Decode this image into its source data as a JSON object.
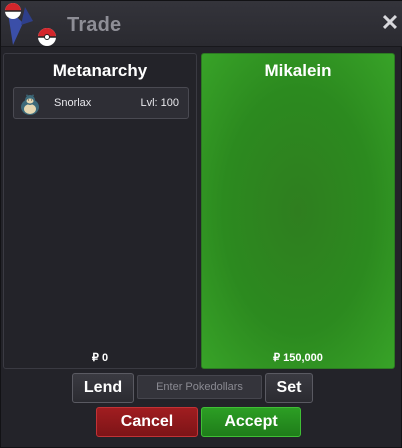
{
  "window": {
    "title": "Trade",
    "close_glyph": "✕",
    "logo_icon": "pokeball-logo-icon"
  },
  "left_panel": {
    "player_name": "Metanarchy",
    "items": [
      {
        "name": "Snorlax",
        "level": "Lvl: 100",
        "icon": "snorlax-sprite-icon"
      }
    ],
    "money": "₽ 0"
  },
  "right_panel": {
    "player_name": "Mikalein",
    "items": [],
    "money": "₽ 150,000",
    "accepted_color": "#2c8a1f"
  },
  "controls": {
    "lend_label": "Lend",
    "money_placeholder": "Enter Pokedollars",
    "set_label": "Set",
    "cancel_label": "Cancel",
    "accept_label": "Accept"
  },
  "colors": {
    "accept_green": "#1f7d1a",
    "cancel_red": "#8a171a"
  }
}
